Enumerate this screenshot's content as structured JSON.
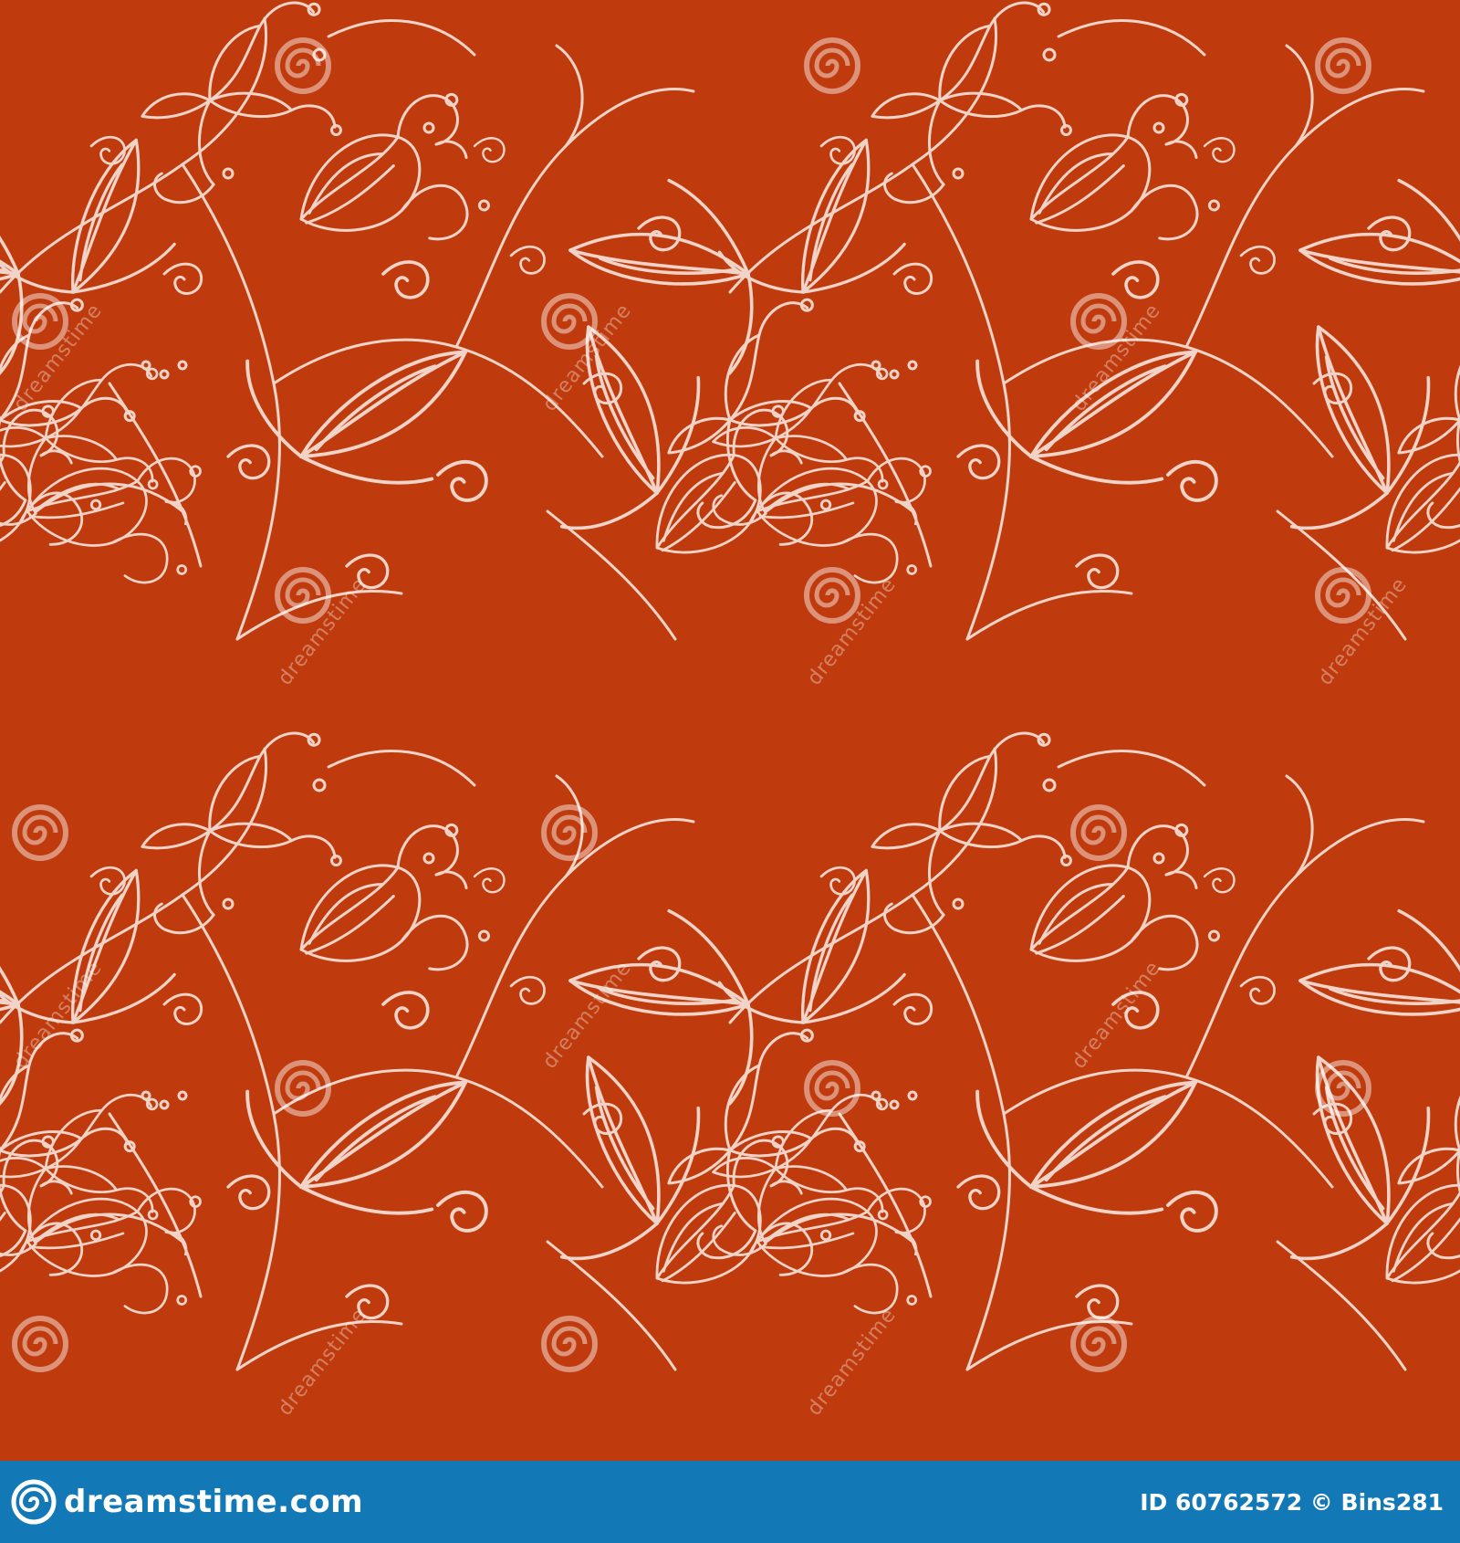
{
  "background_color": "#bf3b0e",
  "line_color": "#f4ddd2",
  "watermark": {
    "text": "dreamstime",
    "spiral_icon": "dreamstime-spiral-icon"
  },
  "footer": {
    "site": "dreamstime.com",
    "credit": "ID 60762572 © Bins281",
    "logo_icon": "dreamstime-logo-icon",
    "color": "#1279b6"
  }
}
